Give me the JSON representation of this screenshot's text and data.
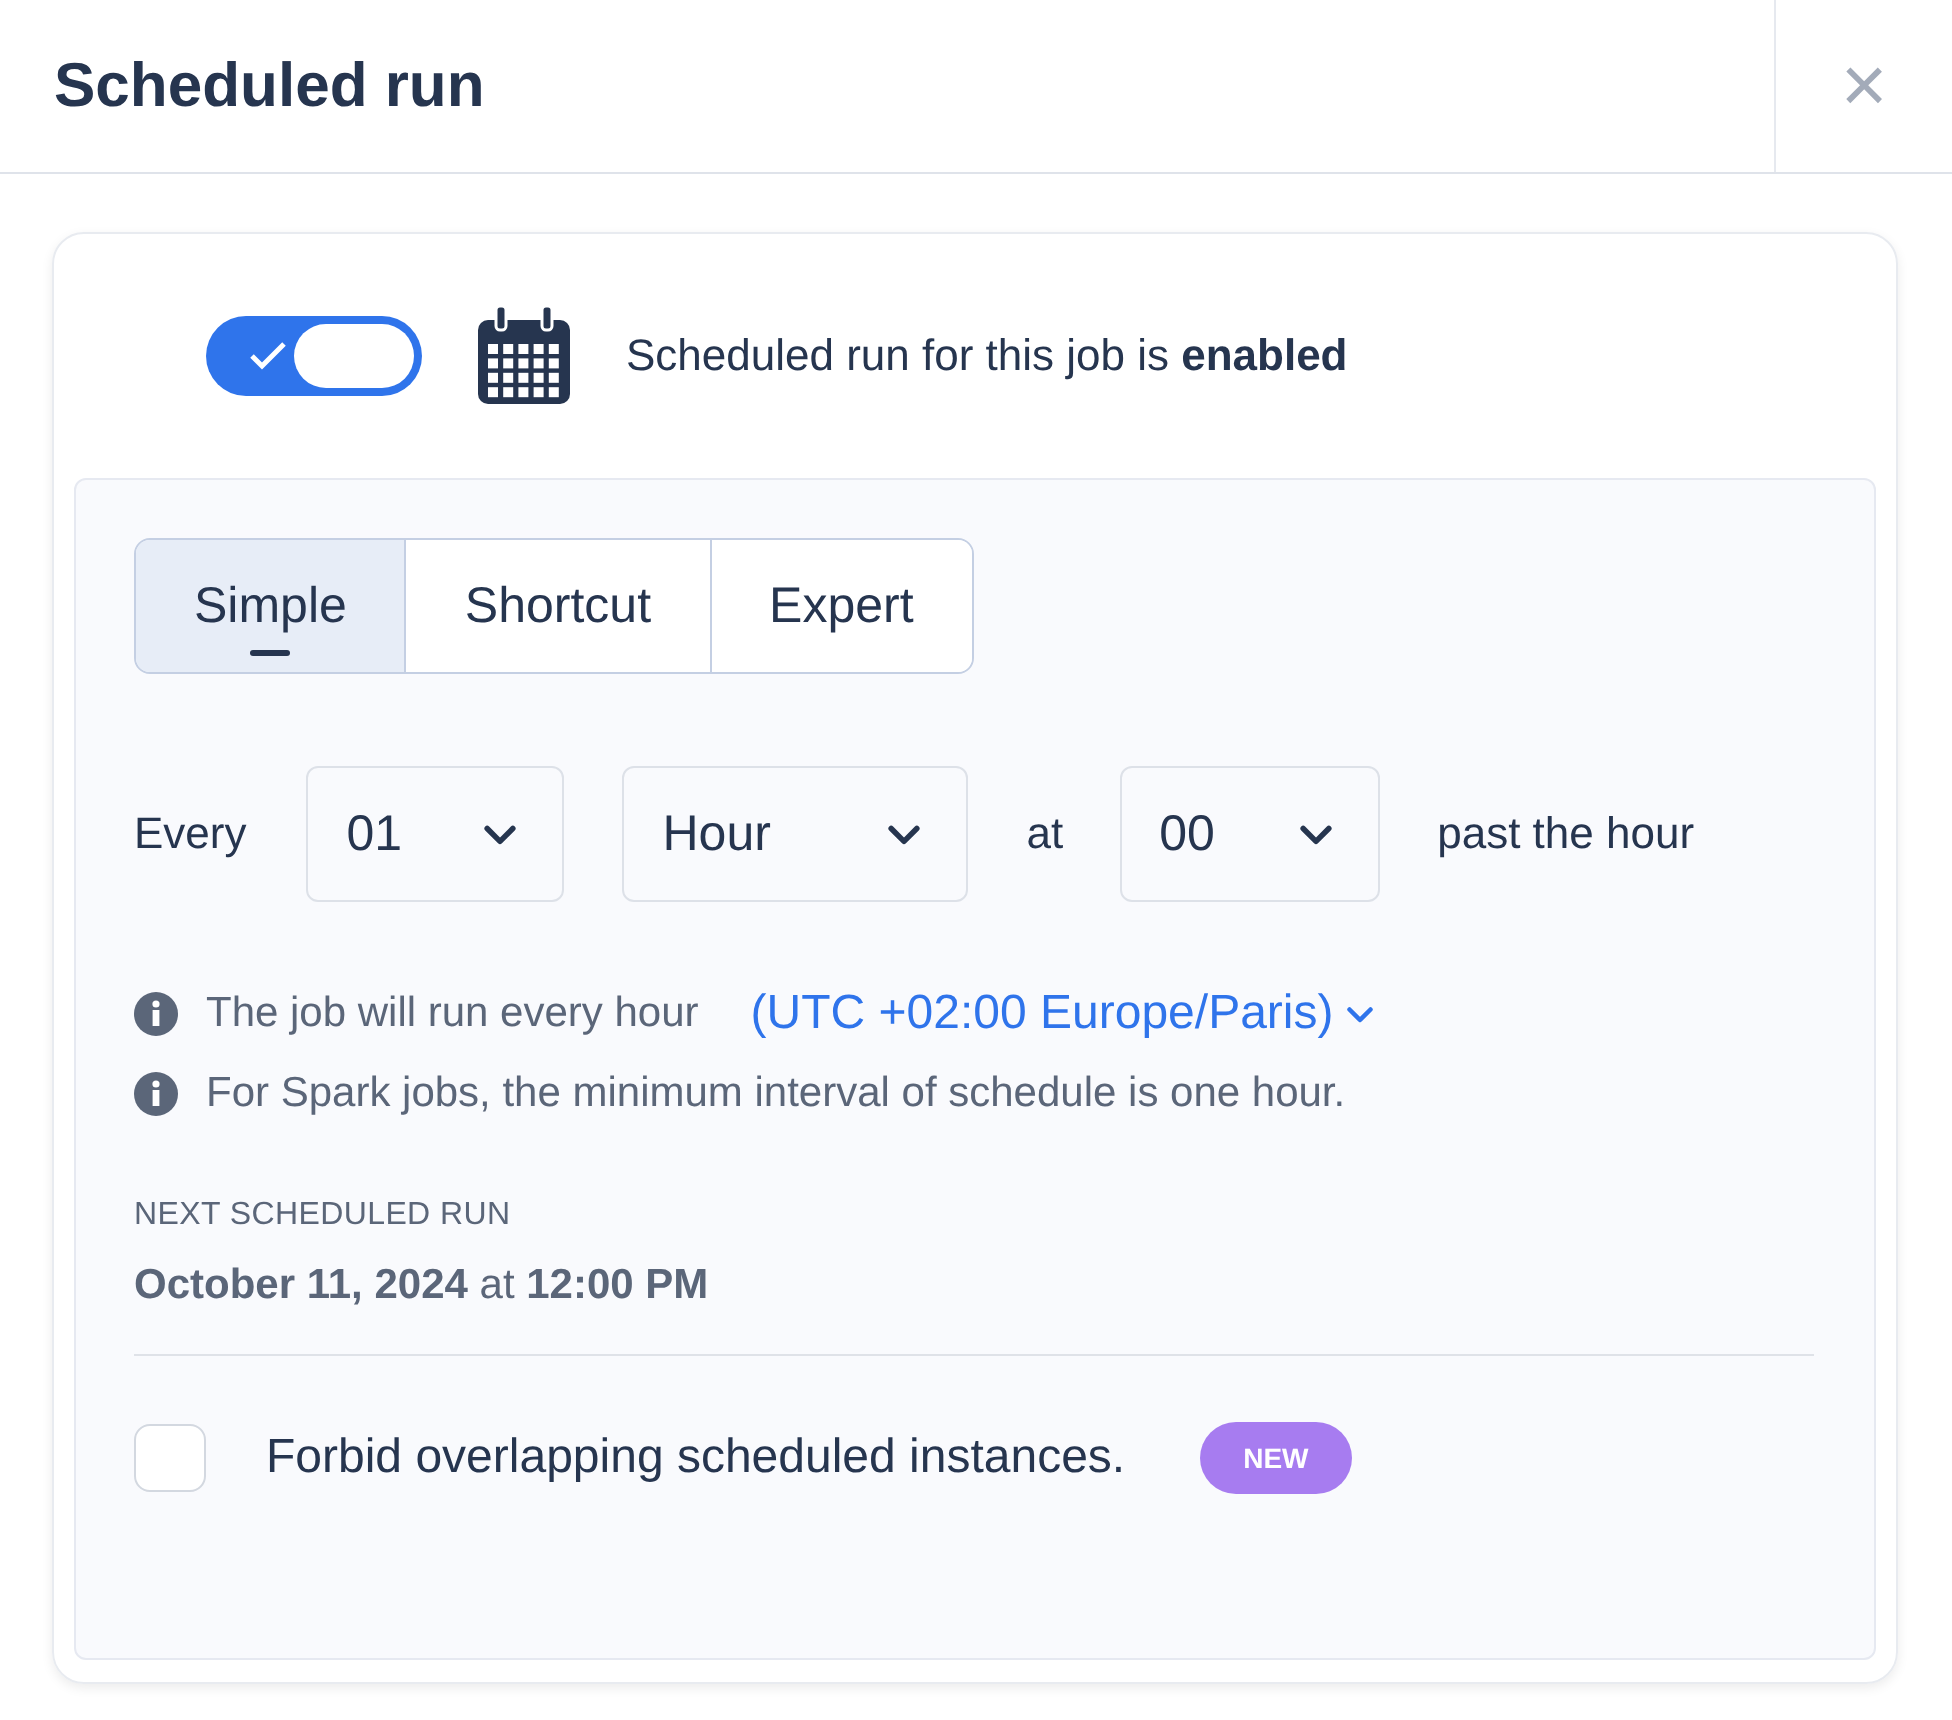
{
  "dialog": {
    "title": "Scheduled run",
    "close": "×"
  },
  "schedule": {
    "enabled": true,
    "status_text": "Scheduled run for this job is **enabled**"
  },
  "tabs": [
    {
      "label": "Simple",
      "selected": true
    },
    {
      "label": "Shortcut",
      "selected": false
    },
    {
      "label": "Expert",
      "selected": false
    }
  ],
  "frequency": {
    "every_label": "Every",
    "count": "01",
    "unit": "Hour",
    "at_label": "at",
    "minute": "00",
    "suffix": "past the hour"
  },
  "info": [
    {
      "text": "The job will run every hour",
      "timezone": "(UTC +02:00 Europe/Paris)"
    },
    {
      "text": "For Spark jobs, the minimum interval of schedule is one hour."
    }
  ],
  "next_run": {
    "label": "NEXT SCHEDULED RUN",
    "value": "**October 11, 2024** at **12:00 PM**"
  },
  "overlap": {
    "checked": false,
    "label": "Forbid overlapping scheduled instances.",
    "badge": "NEW"
  }
}
